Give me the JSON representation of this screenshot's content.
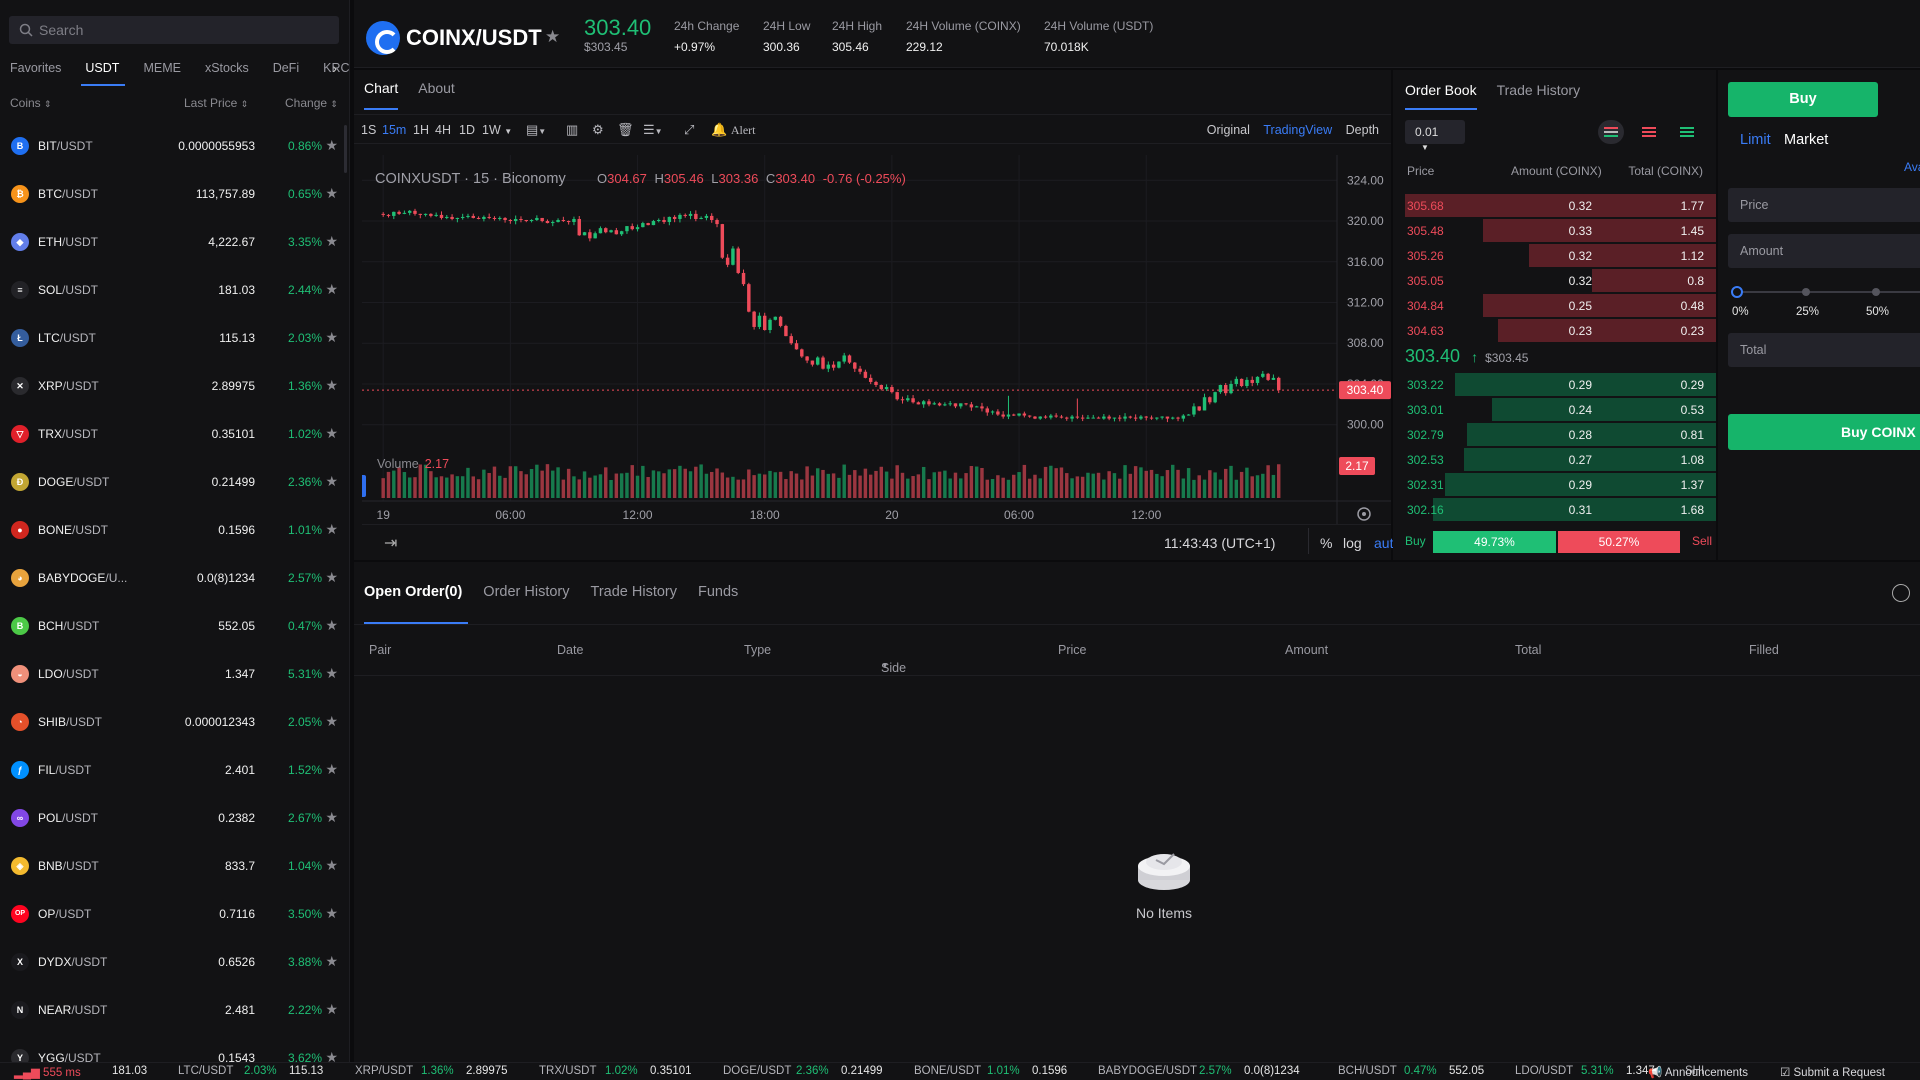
{
  "sidebar": {
    "search_placeholder": "Search",
    "tabs": [
      "Favorites",
      "USDT",
      "MEME",
      "xStocks",
      "DeFi",
      "KRC"
    ],
    "active_tab": "USDT",
    "columns": {
      "coins": "Coins",
      "last_price": "Last Price",
      "change": "Change"
    },
    "coins": [
      {
        "base": "BIT",
        "quote": "/USDT",
        "price": "0.0000055953",
        "change": "0.86%",
        "color": "#1f6ff1",
        "glyph": "B"
      },
      {
        "base": "BTC",
        "quote": "/USDT",
        "price": "113,757.89",
        "change": "0.65%",
        "color": "#f7931a",
        "glyph": "₿"
      },
      {
        "base": "ETH",
        "quote": "/USDT",
        "price": "4,222.67",
        "change": "3.35%",
        "color": "#627eea",
        "glyph": "◆"
      },
      {
        "base": "SOL",
        "quote": "/USDT",
        "price": "181.03",
        "change": "2.44%",
        "color": "#222226",
        "glyph": "≡"
      },
      {
        "base": "LTC",
        "quote": "/USDT",
        "price": "115.13",
        "change": "2.03%",
        "color": "#345d9d",
        "glyph": "Ł"
      },
      {
        "base": "XRP",
        "quote": "/USDT",
        "price": "2.89975",
        "change": "1.36%",
        "color": "#2a2a2e",
        "glyph": "✕"
      },
      {
        "base": "TRX",
        "quote": "/USDT",
        "price": "0.35101",
        "change": "1.02%",
        "color": "#e0202a",
        "glyph": "▽"
      },
      {
        "base": "DOGE",
        "quote": "/USDT",
        "price": "0.21499",
        "change": "2.36%",
        "color": "#c2a633",
        "glyph": "Ð"
      },
      {
        "base": "BONE",
        "quote": "/USDT",
        "price": "0.1596",
        "change": "1.01%",
        "color": "#d0271f",
        "glyph": "●"
      },
      {
        "base": "BABYDOGE",
        "quote": "/U...",
        "price": "0.0(8)1234",
        "change": "2.57%",
        "color": "#e8a33d",
        "glyph": "◕"
      },
      {
        "base": "BCH",
        "quote": "/USDT",
        "price": "552.05",
        "change": "0.47%",
        "color": "#4cc947",
        "glyph": "B"
      },
      {
        "base": "LDO",
        "quote": "/USDT",
        "price": "1.347",
        "change": "5.31%",
        "color": "#f0907a",
        "glyph": "◒"
      },
      {
        "base": "SHIB",
        "quote": "/USDT",
        "price": "0.000012343",
        "change": "2.05%",
        "color": "#e4502a",
        "glyph": "◔"
      },
      {
        "base": "FIL",
        "quote": "/USDT",
        "price": "2.401",
        "change": "1.52%",
        "color": "#0090ff",
        "glyph": "ƒ"
      },
      {
        "base": "POL",
        "quote": "/USDT",
        "price": "0.2382",
        "change": "2.67%",
        "color": "#8247e5",
        "glyph": "∞"
      },
      {
        "base": "BNB",
        "quote": "/USDT",
        "price": "833.7",
        "change": "1.04%",
        "color": "#f3ba2f",
        "glyph": "◈"
      },
      {
        "base": "OP",
        "quote": "/USDT",
        "price": "0.7116",
        "change": "3.50%",
        "color": "#ff0420",
        "glyph": "OP"
      },
      {
        "base": "DYDX",
        "quote": "/USDT",
        "price": "0.6526",
        "change": "3.88%",
        "color": "#1a1a1e",
        "glyph": "X"
      },
      {
        "base": "NEAR",
        "quote": "/USDT",
        "price": "2.481",
        "change": "2.22%",
        "color": "#1a1a1e",
        "glyph": "N"
      },
      {
        "base": "YGG",
        "quote": "/USDT",
        "price": "0.1543",
        "change": "3.62%",
        "color": "#2a2a2e",
        "glyph": "Y"
      }
    ]
  },
  "header": {
    "pair": "COINX/USDT",
    "last_price": "303.40",
    "last_price_usd": "$303.45",
    "stats": [
      {
        "label": "24h Change",
        "value": "+0.97%",
        "tone": "green"
      },
      {
        "label": "24H Low",
        "value": "300.36",
        "tone": "plain"
      },
      {
        "label": "24H High",
        "value": "305.46",
        "tone": "plain"
      },
      {
        "label": "24H Volume (COINX)",
        "value": "229.12",
        "tone": "plain"
      },
      {
        "label": "24H Volume (USDT)",
        "value": "70.018K",
        "tone": "plain"
      }
    ]
  },
  "chart_panel": {
    "tabs": [
      "Chart",
      "About"
    ],
    "timeframes": [
      "1S",
      "15m",
      "1H",
      "4H",
      "1D",
      "1W"
    ],
    "active_timeframe": "15m",
    "alert_label": "Alert",
    "views": [
      "Original",
      "TradingView",
      "Depth"
    ],
    "active_view": "TradingView",
    "legend": {
      "symbol": "COINXUSDT · 15 · Biconomy",
      "o": "304.67",
      "h": "305.46",
      "l": "303.36",
      "c": "303.40",
      "chg": "-0.76 (-0.25%)"
    },
    "volume_label": "Volume",
    "volume_value": "2.17",
    "clock": "11:43:43 (UTC+1)",
    "footer_opts": [
      "%",
      "log",
      "auto"
    ]
  },
  "chart_data": {
    "type": "candlestick",
    "y_ticks": [
      "324.00",
      "320.00",
      "316.00",
      "312.00",
      "308.00",
      "304.00",
      "300.00"
    ],
    "ylim": [
      298.5,
      325.5
    ],
    "x_ticks": [
      "19",
      "06:00",
      "12:00",
      "18:00",
      "20",
      "06:00",
      "12:00"
    ],
    "last_price_label": "303.40",
    "last_volume_label": "2.17",
    "close_path": [
      320.6,
      320.5,
      320.9,
      320.7,
      320.8,
      321.0,
      320.7,
      320.6,
      320.7,
      320.5,
      320.6,
      320.3,
      320.4,
      320.2,
      320.3,
      320.4,
      320.5,
      320.3,
      320.2,
      320.4,
      320.3,
      320.2,
      320.3,
      320.1,
      320.0,
      320.2,
      320.1,
      320.0,
      320.1,
      320.3,
      320.0,
      319.8,
      319.9,
      320.1,
      320.0,
      319.9,
      320.2,
      318.6,
      318.9,
      318.3,
      318.8,
      319.3,
      318.9,
      319.1,
      318.7,
      319.0,
      319.5,
      319.2,
      319.4,
      319.8,
      319.6,
      320.0,
      320.1,
      319.9,
      320.4,
      320.2,
      320.6,
      320.5,
      320.7,
      320.2,
      320.3,
      320.5,
      320.1,
      319.7,
      316.4,
      315.7,
      317.3,
      314.9,
      313.8,
      311.1,
      309.6,
      310.7,
      309.3,
      310.3,
      310.6,
      309.7,
      308.7,
      308.0,
      307.4,
      306.7,
      306.3,
      305.9,
      306.6,
      305.5,
      305.9,
      305.6,
      306.2,
      306.8,
      306.1,
      305.5,
      305.2,
      304.6,
      304.2,
      303.9,
      303.5,
      303.7,
      303.2,
      302.5,
      302.4,
      302.6,
      302.2,
      302.0,
      302.3,
      302.0,
      302.1,
      301.9,
      302.0,
      302.1,
      301.8,
      302.1,
      302.0,
      301.7,
      301.8,
      301.6,
      301.2,
      301.3,
      301.0,
      300.8,
      301.0,
      300.9,
      301.1,
      300.9,
      300.8,
      300.6,
      300.8,
      300.7,
      300.9,
      300.8,
      300.7,
      300.6,
      300.8,
      300.7,
      300.6,
      300.7,
      300.7,
      300.6,
      300.8,
      300.6,
      300.7,
      300.6,
      300.8,
      300.7,
      300.6,
      300.8,
      300.7,
      300.6,
      300.7,
      300.8,
      300.6,
      300.7,
      300.6,
      300.9,
      301.0,
      301.8,
      301.4,
      302.7,
      302.2,
      303.2,
      303.9,
      303.1,
      304.0,
      304.5,
      303.8,
      304.4,
      304.1,
      304.7,
      305.0,
      304.4,
      304.6,
      303.4
    ],
    "xrange": [
      -4,
      180
    ]
  },
  "order_book": {
    "tabs": [
      "Order Book",
      "Trade History"
    ],
    "precision": "0.01",
    "columns": {
      "price": "Price",
      "amount": "Amount (COINX)",
      "total": "Total (COINX)"
    },
    "asks": [
      {
        "price": "305.68",
        "amount": "0.32",
        "total": "1.77",
        "depth": 1.0
      },
      {
        "price": "305.48",
        "amount": "0.33",
        "total": "1.45",
        "depth": 0.75
      },
      {
        "price": "305.26",
        "amount": "0.32",
        "total": "1.12",
        "depth": 0.6
      },
      {
        "price": "305.05",
        "amount": "0.32",
        "total": "0.8",
        "depth": 0.4
      },
      {
        "price": "304.84",
        "amount": "0.25",
        "total": "0.48",
        "depth": 0.75
      },
      {
        "price": "304.63",
        "amount": "0.23",
        "total": "0.23",
        "depth": 0.7
      }
    ],
    "mid_price": "303.40",
    "mid_price_usd": "$303.45",
    "bids": [
      {
        "price": "303.22",
        "amount": "0.29",
        "total": "0.29",
        "depth": 0.84
      },
      {
        "price": "303.01",
        "amount": "0.24",
        "total": "0.53",
        "depth": 0.72
      },
      {
        "price": "302.79",
        "amount": "0.28",
        "total": "0.81",
        "depth": 0.8
      },
      {
        "price": "302.53",
        "amount": "0.27",
        "total": "1.08",
        "depth": 0.81
      },
      {
        "price": "302.31",
        "amount": "0.29",
        "total": "1.37",
        "depth": 0.87
      },
      {
        "price": "302.16",
        "amount": "0.31",
        "total": "1.68",
        "depth": 0.91
      }
    ],
    "buy_label": "Buy",
    "buy_ratio": "49.73%",
    "sell_ratio": "50.27%",
    "sell_label": "Sell",
    "buy_fraction": 0.4973
  },
  "order_form": {
    "buy_tab": "Buy",
    "type_tabs": [
      "Limit",
      "Market"
    ],
    "active_type": "Limit",
    "avail_label": "Ava",
    "price_placeholder": "Price",
    "amount_placeholder": "Amount",
    "slider_marks": [
      "0%",
      "25%",
      "50%"
    ],
    "total_placeholder": "Total",
    "submit_label": "Buy COINX"
  },
  "orders": {
    "tabs": [
      "Open Order(0)",
      "Order History",
      "Trade History",
      "Funds"
    ],
    "columns": [
      "Pair",
      "Date",
      "Type",
      "Side",
      "Price",
      "Amount",
      "Total",
      "Filled"
    ],
    "empty_text": "No Items"
  },
  "status_bar": {
    "latency": "555 ms",
    "ticks": [
      {
        "text": "181.03",
        "tone": "plain"
      },
      {
        "text": "LTC/USDT",
        "tone": "muted"
      },
      {
        "text": "2.03%",
        "tone": "green"
      },
      {
        "text": "115.13",
        "tone": "plain"
      },
      {
        "text": "XRP/USDT",
        "tone": "muted"
      },
      {
        "text": "1.36%",
        "tone": "green"
      },
      {
        "text": "2.89975",
        "tone": "plain"
      },
      {
        "text": "TRX/USDT",
        "tone": "muted"
      },
      {
        "text": "1.02%",
        "tone": "green"
      },
      {
        "text": "0.35101",
        "tone": "plain"
      },
      {
        "text": "DOGE/USDT",
        "tone": "muted"
      },
      {
        "text": "2.36%",
        "tone": "green"
      },
      {
        "text": "0.21499",
        "tone": "plain"
      },
      {
        "text": "BONE/USDT",
        "tone": "muted"
      },
      {
        "text": "1.01%",
        "tone": "green"
      },
      {
        "text": "0.1596",
        "tone": "plain"
      },
      {
        "text": "BABYDOGE/USDT",
        "tone": "muted"
      },
      {
        "text": "2.57%",
        "tone": "green"
      },
      {
        "text": "0.0(8)1234",
        "tone": "plain"
      },
      {
        "text": "BCH/USDT",
        "tone": "muted"
      },
      {
        "text": "0.47%",
        "tone": "green"
      },
      {
        "text": "552.05",
        "tone": "plain"
      },
      {
        "text": "LDO/USDT",
        "tone": "muted"
      },
      {
        "text": "5.31%",
        "tone": "green"
      },
      {
        "text": "1.347",
        "tone": "plain"
      },
      {
        "text": "SHI",
        "tone": "muted"
      }
    ],
    "announcements": "Announcements",
    "submit_request": "Submit a Request"
  },
  "colors": {
    "accent": "#3a7cf6",
    "up": "#1fbf75",
    "down": "#ee4b5a",
    "panel": "#121214"
  }
}
